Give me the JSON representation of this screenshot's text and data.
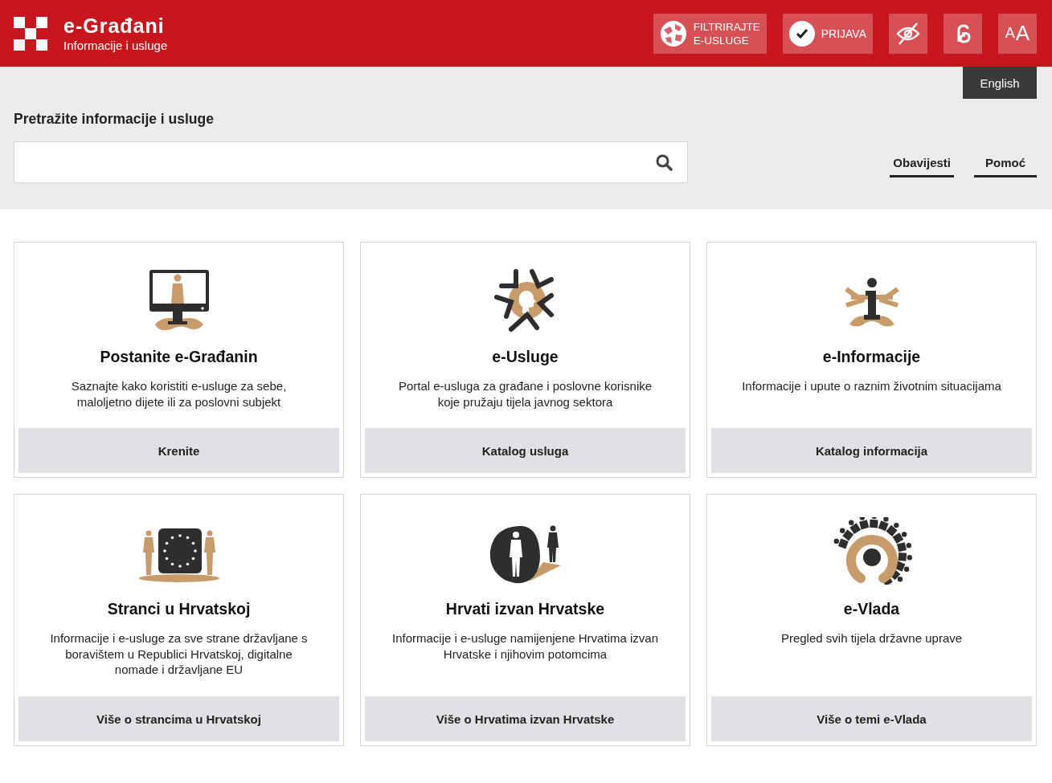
{
  "header": {
    "title": "e-Građani",
    "subtitle": "Informacije i usluge",
    "filter_button": {
      "lines": [
        "FILTRIRAJTE",
        "E-USLUGE"
      ]
    },
    "login_button": {
      "label": "PRIJAVA"
    },
    "font_size_button": {
      "small": "A",
      "large": "A"
    }
  },
  "language_button": {
    "label": "English"
  },
  "search": {
    "heading": "Pretražite informacije i usluge"
  },
  "links": [
    {
      "label": "Obavijesti"
    },
    {
      "label": "Pomoć"
    }
  ],
  "cards": [
    {
      "title": "Postanite e-Građanin",
      "description": "Saznajte kako koristiti e-usluge za sebe, maloljetno dijete ili za poslovni subjekt",
      "button": "Krenite"
    },
    {
      "title": "e-Usluge",
      "description": "Portal e-usluga za građane i poslovne korisnike koje pružaju tijela javnog sektora",
      "button": "Katalog usluga"
    },
    {
      "title": "e-Informacije",
      "description": "Informacije i upute o raznim životnim situacijama",
      "button": "Katalog informacija"
    },
    {
      "title": "Stranci u Hrvatskoj",
      "description": "Informacije i e-usluge za sve strane državljane s boravištem u Republici Hrvatskoj, digitalne nomade i državljane EU",
      "button": "Više o strancima u Hrvatskoj"
    },
    {
      "title": "Hrvati izvan Hrvatske",
      "description": "Informacije i e-usluge namijenjene Hrvatima izvan Hrvatske i njihovim potomcima",
      "button": "Više o Hrvatima izvan Hrvatske"
    },
    {
      "title": "e-Vlada",
      "description": "Pregled svih tijela državne uprave",
      "button": "Više o temi e-Vlada"
    }
  ]
}
